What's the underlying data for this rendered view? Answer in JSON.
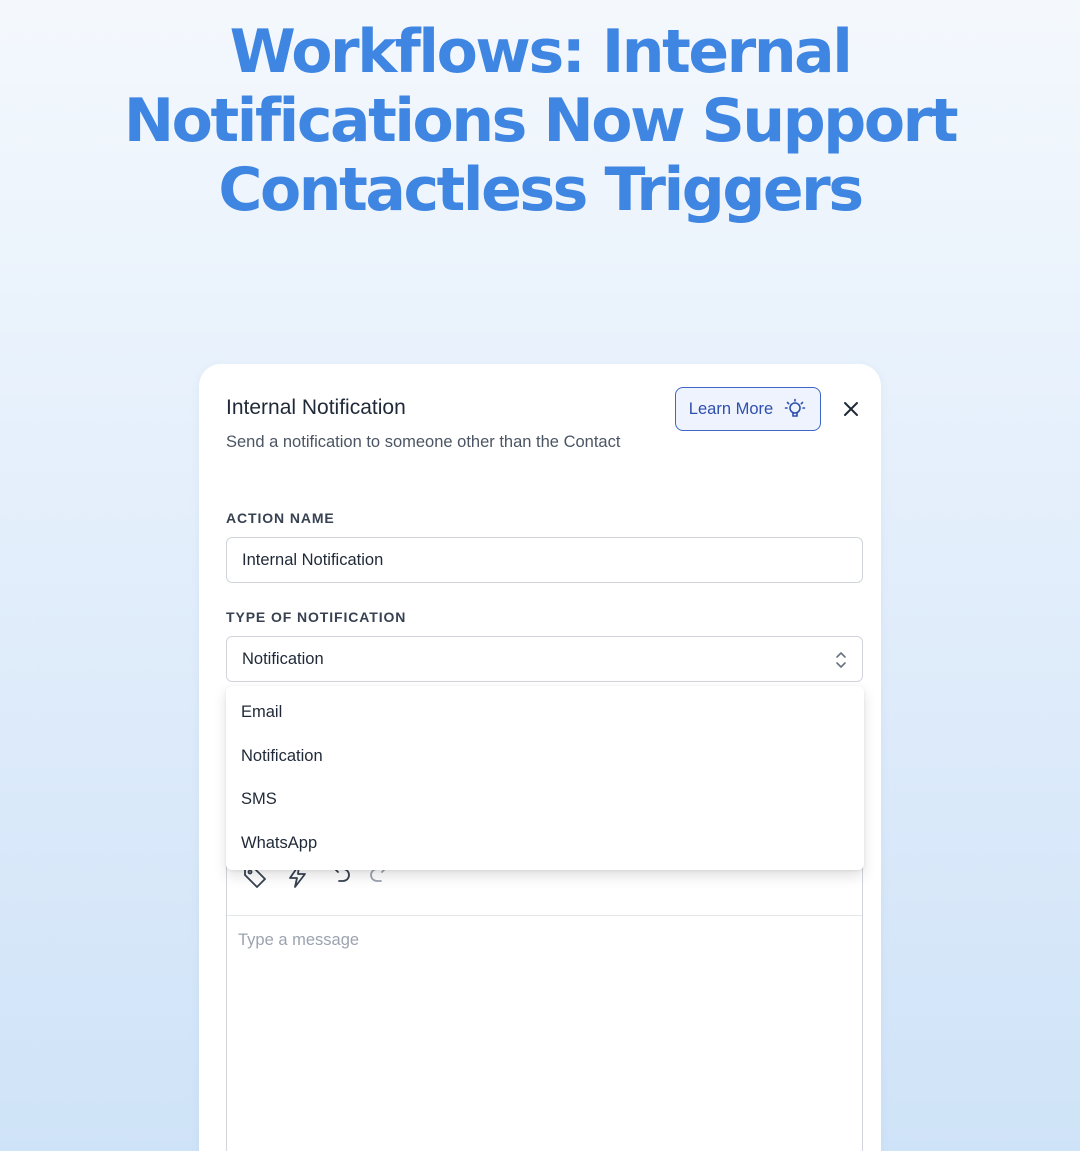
{
  "headline": {
    "line1": "Workflows: Internal",
    "line2": "Notifications Now Support",
    "line3": "Contactless Triggers",
    "color": "#3f86e2"
  },
  "panel": {
    "title": "Internal Notification",
    "subtitle": "Send a notification to someone other than the Contact",
    "learn_more_label": "Learn More",
    "learn_more_icon": "lightbulb-icon",
    "close_icon": "close-icon"
  },
  "form": {
    "action_name_label": "ACTION NAME",
    "action_name_value": "Internal Notification",
    "type_label": "TYPE OF NOTIFICATION",
    "type_value": "Notification",
    "type_options": [
      "Email",
      "Notification",
      "SMS",
      "WhatsApp"
    ]
  },
  "editor": {
    "toolbar_icons": [
      "tag-icon",
      "bolt-icon",
      "undo-icon",
      "redo-icon"
    ],
    "placeholder": "Type a message"
  },
  "colors": {
    "accent": "#3f67c9",
    "accent_bg": "#eef3fd"
  }
}
